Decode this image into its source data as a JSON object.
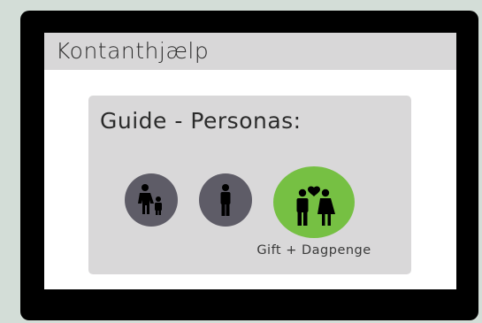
{
  "header": {
    "title": "Kontanthjælp"
  },
  "guide": {
    "title": "Guide - Personas:",
    "personas": [
      {
        "icon": "parent-with-child-icon",
        "label": ""
      },
      {
        "icon": "single-person-icon",
        "label": ""
      },
      {
        "icon": "married-couple-icon",
        "label": "Gift + Dagpenge",
        "selected": true
      }
    ]
  },
  "colors": {
    "background": "#d3ddd7",
    "frame": "#000000",
    "header_bg": "#d8d7d8",
    "card_bg": "#d9d8d9",
    "persona_default": "#5e5c67",
    "persona_selected": "#76c043"
  }
}
